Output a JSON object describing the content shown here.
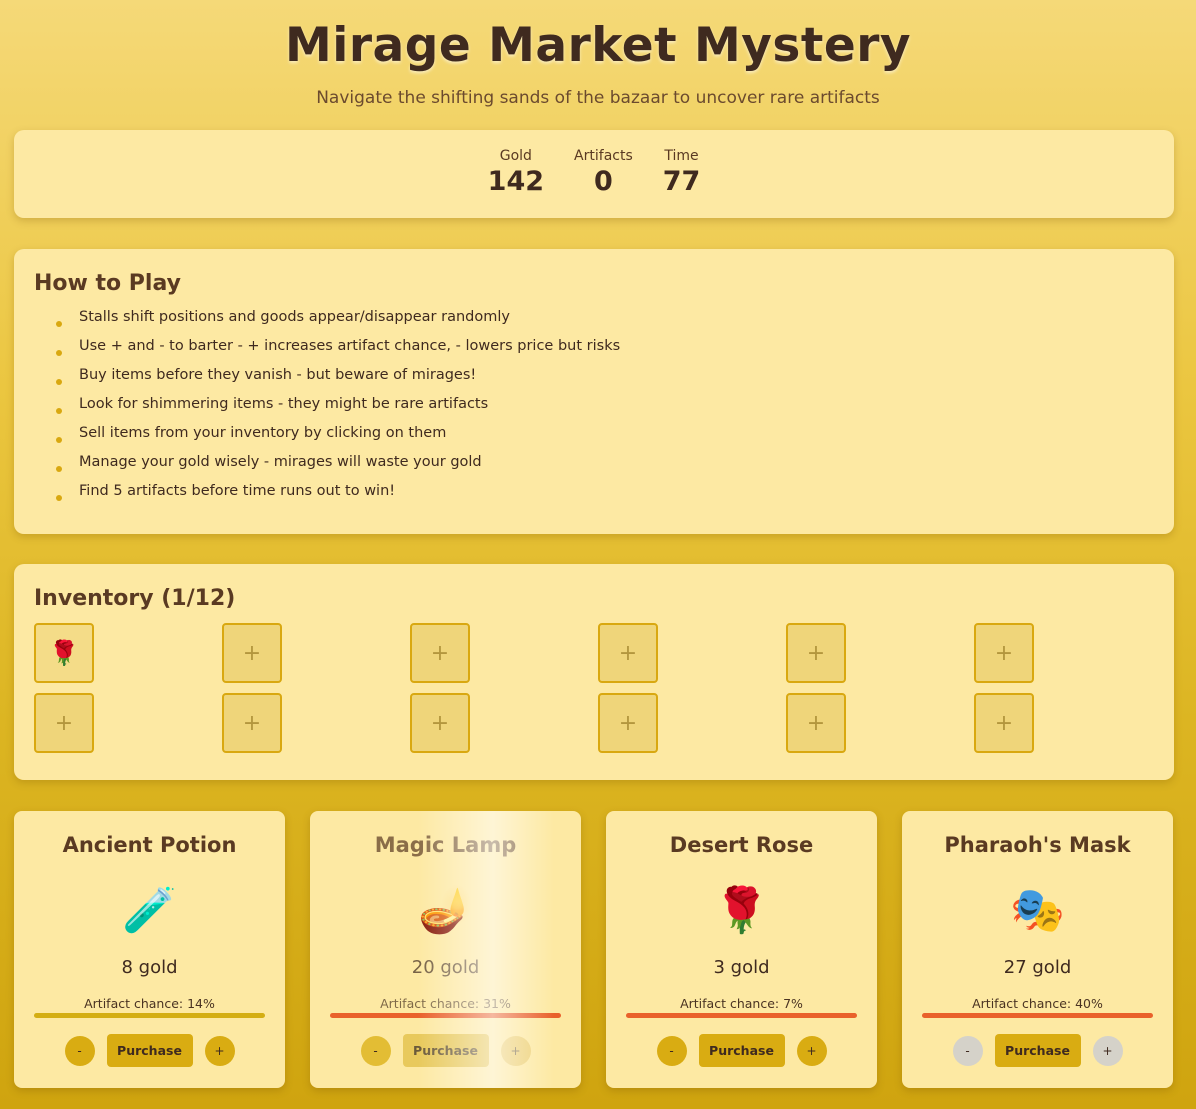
{
  "header": {
    "title": "Mirage Market Mystery",
    "subtitle": "Navigate the shifting sands of the bazaar to uncover rare artifacts"
  },
  "stats": [
    {
      "label": "Gold",
      "value": "142"
    },
    {
      "label": "Artifacts",
      "value": "0"
    },
    {
      "label": "Time",
      "value": "77"
    }
  ],
  "howto": {
    "title": "How to Play",
    "rules": [
      "Stalls shift positions and goods appear/disappear randomly",
      "Use + and - to barter - + increases artifact chance, - lowers price but risks",
      "Buy items before they vanish - but beware of mirages!",
      "Look for shimmering items - they might be rare artifacts",
      "Sell items from your inventory by clicking on them",
      "Manage your gold wisely - mirages will waste your gold",
      "Find 5 artifacts before time runs out to win!"
    ]
  },
  "inventory": {
    "title": "Inventory (1/12)",
    "empty_symbol": "+",
    "slots": [
      "🌹",
      "",
      "",
      "",
      "",
      "",
      "",
      "",
      "",
      "",
      "",
      ""
    ]
  },
  "stalls": [
    {
      "name": "Ancient Potion",
      "icon": "🧪",
      "price": "8 gold",
      "chance_label": "Artifact chance: 14%",
      "chance": 14,
      "bar_color": "#d4ae14",
      "minus": "-",
      "purchase": "Purchase",
      "plus": "+"
    },
    {
      "name": "Magic Lamp",
      "icon": "🪔",
      "price": "20 gold",
      "chance_label": "Artifact chance: 31%",
      "chance": 31,
      "bar_color": "#e9612b",
      "minus": "-",
      "purchase": "Purchase",
      "plus": "+"
    },
    {
      "name": "Desert Rose",
      "icon": "🌹",
      "price": "3 gold",
      "chance_label": "Artifact chance: 7%",
      "chance": 7,
      "bar_color": "#e9612b",
      "minus": "-",
      "purchase": "Purchase",
      "plus": "+"
    },
    {
      "name": "Pharaoh's Mask",
      "icon": "🎭",
      "price": "27 gold",
      "chance_label": "Artifact chance: 40%",
      "chance": 40,
      "bar_color": "#e9612b",
      "minus": "-",
      "purchase": "Purchase",
      "plus": "+"
    }
  ]
}
